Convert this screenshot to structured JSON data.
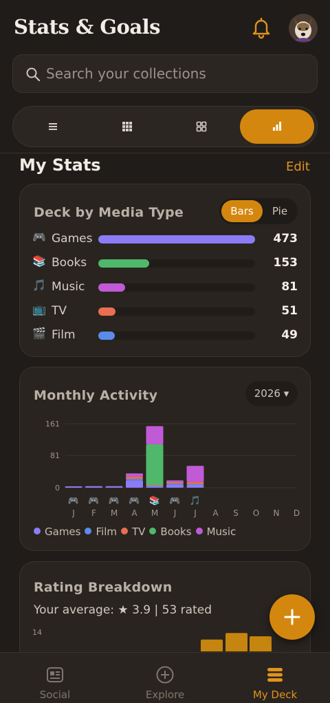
{
  "header": {
    "title": "Stats & Goals",
    "bell_icon": "bell-icon",
    "avatar_alt": "user avatar"
  },
  "search": {
    "placeholder": "Search your collections"
  },
  "view_toggle": {
    "options": [
      {
        "name": "list",
        "icon": "list-icon",
        "active": false
      },
      {
        "name": "grid-small",
        "icon": "grid-small-icon",
        "active": false
      },
      {
        "name": "grid-large",
        "icon": "grid-large-icon",
        "active": false
      },
      {
        "name": "stats",
        "icon": "bar-chart-icon",
        "active": true
      }
    ]
  },
  "section": {
    "title": "My Stats",
    "edit_label": "Edit"
  },
  "deck_by_media": {
    "title": "Deck by Media Type",
    "toggle": {
      "bars_label": "Bars",
      "pie_label": "Pie",
      "selected": "Bars"
    },
    "rows": [
      {
        "emoji": "🎮",
        "label": "Games",
        "count": "473",
        "value": 473,
        "color": "#8b7cf6"
      },
      {
        "emoji": "📚",
        "label": "Books",
        "count": "153",
        "value": 153,
        "color": "#4fb86a"
      },
      {
        "emoji": "🎵",
        "label": "Music",
        "count": "81",
        "value": 81,
        "color": "#c15ad6"
      },
      {
        "emoji": "📺",
        "label": "TV",
        "count": "51",
        "value": 51,
        "color": "#e86f52"
      },
      {
        "emoji": "🎬",
        "label": "Film",
        "count": "49",
        "value": 49,
        "color": "#5b8be8"
      }
    ]
  },
  "monthly_activity": {
    "title": "Monthly Activity",
    "year_label": "2026 ▾",
    "legend": [
      {
        "label": "Games",
        "color": "#8b7cf6"
      },
      {
        "label": "Film",
        "color": "#5b8be8"
      },
      {
        "label": "TV",
        "color": "#e86f52"
      },
      {
        "label": "Books",
        "color": "#4fb86a"
      },
      {
        "label": "Music",
        "color": "#c15ad6"
      }
    ]
  },
  "rating_breakdown": {
    "title": "Rating Breakdown",
    "average_text": "Your average: ★ 3.9 | 53 rated",
    "y_tick": "14",
    "bar_color": "#c5850f"
  },
  "fab": {
    "icon": "plus-icon"
  },
  "bottom_nav": {
    "items": [
      {
        "label": "Social",
        "icon": "social-icon",
        "active": false
      },
      {
        "label": "Explore",
        "icon": "explore-icon",
        "active": false
      },
      {
        "label": "My Deck",
        "icon": "deck-icon",
        "active": true
      }
    ]
  },
  "chart_data": [
    {
      "type": "bar",
      "title": "Deck by Media Type",
      "categories": [
        "Games",
        "Books",
        "Music",
        "TV",
        "Film"
      ],
      "values": [
        473,
        153,
        81,
        51,
        49
      ],
      "orientation": "horizontal"
    },
    {
      "type": "bar",
      "stacked": true,
      "title": "Monthly Activity",
      "categories": [
        "J",
        "F",
        "M",
        "A",
        "M",
        "J",
        "J",
        "A",
        "S",
        "O",
        "N",
        "D"
      ],
      "month_icons": [
        "🎮",
        "🎮",
        "🎮",
        "🎮",
        "📚",
        "🎮",
        "🎵",
        "",
        "",
        "",
        "",
        ""
      ],
      "y_ticks": [
        0,
        81,
        161
      ],
      "ylim": [
        0,
        161
      ],
      "series": [
        {
          "name": "Games",
          "color": "#8b7cf6",
          "values": [
            3,
            4,
            4,
            18,
            3,
            8,
            6,
            0,
            0,
            0,
            0,
            0
          ]
        },
        {
          "name": "Film",
          "color": "#5b8be8",
          "values": [
            0,
            0,
            0,
            4,
            2,
            3,
            3,
            0,
            0,
            0,
            0,
            0
          ]
        },
        {
          "name": "TV",
          "color": "#e86f52",
          "values": [
            0,
            0,
            0,
            6,
            2,
            4,
            6,
            0,
            0,
            0,
            0,
            0
          ]
        },
        {
          "name": "Books",
          "color": "#4fb86a",
          "values": [
            0,
            0,
            0,
            0,
            102,
            0,
            0,
            0,
            0,
            0,
            0,
            0
          ]
        },
        {
          "name": "Music",
          "color": "#c15ad6",
          "values": [
            0,
            0,
            0,
            8,
            46,
            3,
            40,
            0,
            0,
            0,
            0,
            0
          ]
        }
      ],
      "legend_position": "bottom",
      "grid": true
    },
    {
      "type": "bar",
      "title": "Rating Breakdown",
      "y_ticks": [
        14
      ],
      "partially_visible": true,
      "values": [
        8,
        12,
        10
      ]
    }
  ]
}
